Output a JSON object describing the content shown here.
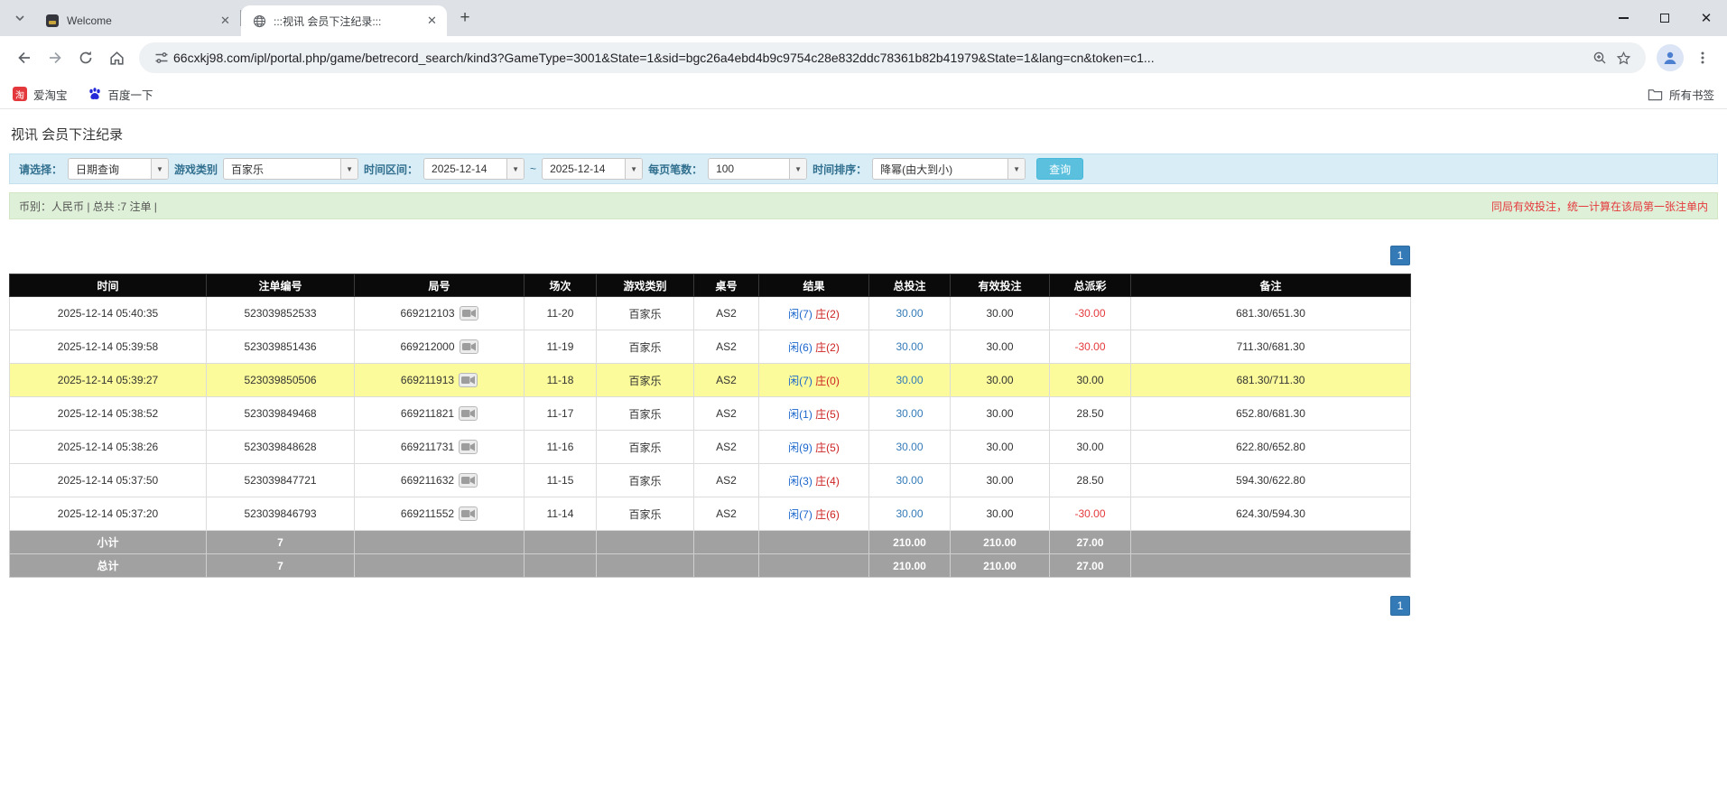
{
  "browser": {
    "tabs": [
      {
        "label": "Welcome"
      },
      {
        "label": ":::视讯 会员下注纪录:::"
      }
    ],
    "url": "66cxkj98.com/ipl/portal.php/game/betrecord_search/kind3?GameType=3001&State=1&sid=bgc26a4ebd4b9c9754c28e832ddc78361b82b41979&State=1&lang=cn&token=c1...",
    "bookmarks": [
      {
        "label": "爱淘宝",
        "icon_text": "淘"
      },
      {
        "label": "百度一下"
      }
    ],
    "all_bookmarks_label": "所有书签"
  },
  "page": {
    "title": "视讯 会员下注纪录",
    "filters": {
      "select_label": "请选择：",
      "select_value": "日期查询",
      "game_type_label": "游戏类别",
      "game_type_value": "百家乐",
      "time_range_label": "时间区间：",
      "date_from": "2025-12-14",
      "tilde": "~",
      "date_to": "2025-12-14",
      "page_size_label": "每页笔数：",
      "page_size_value": "100",
      "sort_label": "时间排序：",
      "sort_value": "降幂(由大到小)",
      "search_button": "查询"
    },
    "info_bar": {
      "left": "币别：人民币 | 总共 :7 注单 |",
      "right": "同局有效投注，统一计算在该局第一张注单内"
    },
    "pagination": "1"
  },
  "table": {
    "headers": [
      "时间",
      "注单编号",
      "局号",
      "场次",
      "游戏类别",
      "桌号",
      "结果",
      "总投注",
      "有效投注",
      "总派彩",
      "备注"
    ],
    "rows": [
      {
        "time": "2025-12-14 05:40:35",
        "bet_id": "523039852533",
        "round": "669212103",
        "session": "11-20",
        "game": "百家乐",
        "table": "AS2",
        "player": "闲(7)",
        "banker": "庄(2)",
        "total_bet": "30.00",
        "valid_bet": "30.00",
        "payout": "-30.00",
        "payout_neg": true,
        "note": "681.30/651.30",
        "highlight": false
      },
      {
        "time": "2025-12-14 05:39:58",
        "bet_id": "523039851436",
        "round": "669212000",
        "session": "11-19",
        "game": "百家乐",
        "table": "AS2",
        "player": "闲(6)",
        "banker": "庄(2)",
        "total_bet": "30.00",
        "valid_bet": "30.00",
        "payout": "-30.00",
        "payout_neg": true,
        "note": "711.30/681.30",
        "highlight": false
      },
      {
        "time": "2025-12-14 05:39:27",
        "bet_id": "523039850506",
        "round": "669211913",
        "session": "11-18",
        "game": "百家乐",
        "table": "AS2",
        "player": "闲(7)",
        "banker": "庄(0)",
        "total_bet": "30.00",
        "valid_bet": "30.00",
        "payout": "30.00",
        "payout_neg": false,
        "note": "681.30/711.30",
        "highlight": true
      },
      {
        "time": "2025-12-14 05:38:52",
        "bet_id": "523039849468",
        "round": "669211821",
        "session": "11-17",
        "game": "百家乐",
        "table": "AS2",
        "player": "闲(1)",
        "banker": "庄(5)",
        "total_bet": "30.00",
        "valid_bet": "30.00",
        "payout": "28.50",
        "payout_neg": false,
        "note": "652.80/681.30",
        "highlight": false
      },
      {
        "time": "2025-12-14 05:38:26",
        "bet_id": "523039848628",
        "round": "669211731",
        "session": "11-16",
        "game": "百家乐",
        "table": "AS2",
        "player": "闲(9)",
        "banker": "庄(5)",
        "total_bet": "30.00",
        "valid_bet": "30.00",
        "payout": "30.00",
        "payout_neg": false,
        "note": "622.80/652.80",
        "highlight": false
      },
      {
        "time": "2025-12-14 05:37:50",
        "bet_id": "523039847721",
        "round": "669211632",
        "session": "11-15",
        "game": "百家乐",
        "table": "AS2",
        "player": "闲(3)",
        "banker": "庄(4)",
        "total_bet": "30.00",
        "valid_bet": "30.00",
        "payout": "28.50",
        "payout_neg": false,
        "note": "594.30/622.80",
        "highlight": false
      },
      {
        "time": "2025-12-14 05:37:20",
        "bet_id": "523039846793",
        "round": "669211552",
        "session": "11-14",
        "game": "百家乐",
        "table": "AS2",
        "player": "闲(7)",
        "banker": "庄(6)",
        "total_bet": "30.00",
        "valid_bet": "30.00",
        "payout": "-30.00",
        "payout_neg": true,
        "note": "624.30/594.30",
        "highlight": false
      }
    ],
    "subtotal": {
      "label": "小计",
      "count": "7",
      "total_bet": "210.00",
      "valid_bet": "210.00",
      "payout": "27.00"
    },
    "total": {
      "label": "总计",
      "count": "7",
      "total_bet": "210.00",
      "valid_bet": "210.00",
      "payout": "27.00"
    }
  },
  "colors": {
    "accent_blue": "#337ab7",
    "search_button": "#5bc0de",
    "filter_bg": "#d9edf7",
    "info_bg": "#dff0d8",
    "highlight_row": "#fbfb9b",
    "header_bg": "#0a0a0a",
    "summary_bg": "#a1a1a1",
    "negative_red": "#e4393c",
    "player_blue": "#1a66cc",
    "banker_red": "#cc2222"
  },
  "icons": [
    "tab-search-chevron",
    "globe",
    "close-x",
    "new-tab-plus",
    "minimize",
    "maximize",
    "back-arrow",
    "forward-arrow",
    "reload",
    "home",
    "site-info-tune",
    "zoom-magnifier",
    "bookmark-star",
    "profile-person",
    "menu-dots",
    "baidu-paw",
    "taobao",
    "bookmarks-folder",
    "video-camera"
  ]
}
